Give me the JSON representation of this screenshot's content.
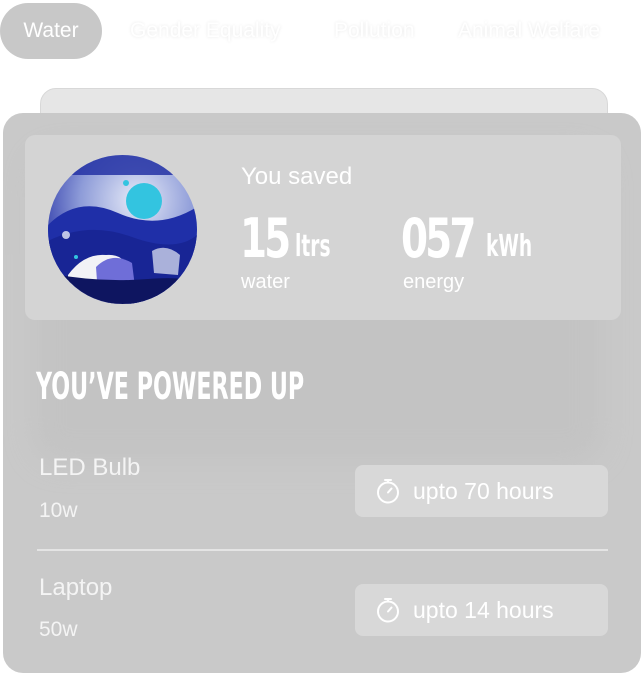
{
  "tabs": [
    {
      "label": "Water",
      "active": true
    },
    {
      "label": "Gender Equality",
      "active": false
    },
    {
      "label": "Pollution",
      "active": false
    },
    {
      "label": "Animal Welfare",
      "active": false
    }
  ],
  "savings": {
    "title": "You saved",
    "water": {
      "value": "15",
      "unit": "ltrs",
      "label": "water"
    },
    "energy": {
      "value": "057",
      "unit": "kWh",
      "label": "energy"
    },
    "illustration_icon": "landscape-illustration"
  },
  "powered": {
    "title": "YOU’VE POWERED UP",
    "devices": [
      {
        "name": "LED Bulb",
        "watt": "10w",
        "duration": "upto 70 hours",
        "icon": "stopwatch-icon"
      },
      {
        "name": "Laptop",
        "watt": "50w",
        "duration": "upto 14 hours",
        "icon": "stopwatch-icon"
      }
    ]
  },
  "colors": {
    "card_background": "#c9c9c9",
    "panel_background": "#d4d4d4",
    "active_tab": "#c8c8c8",
    "text": "#ffffff",
    "illustration_blue": "#1f2fa8",
    "illustration_cyan": "#33c4e0",
    "illustration_purple": "#6f6ed8"
  }
}
